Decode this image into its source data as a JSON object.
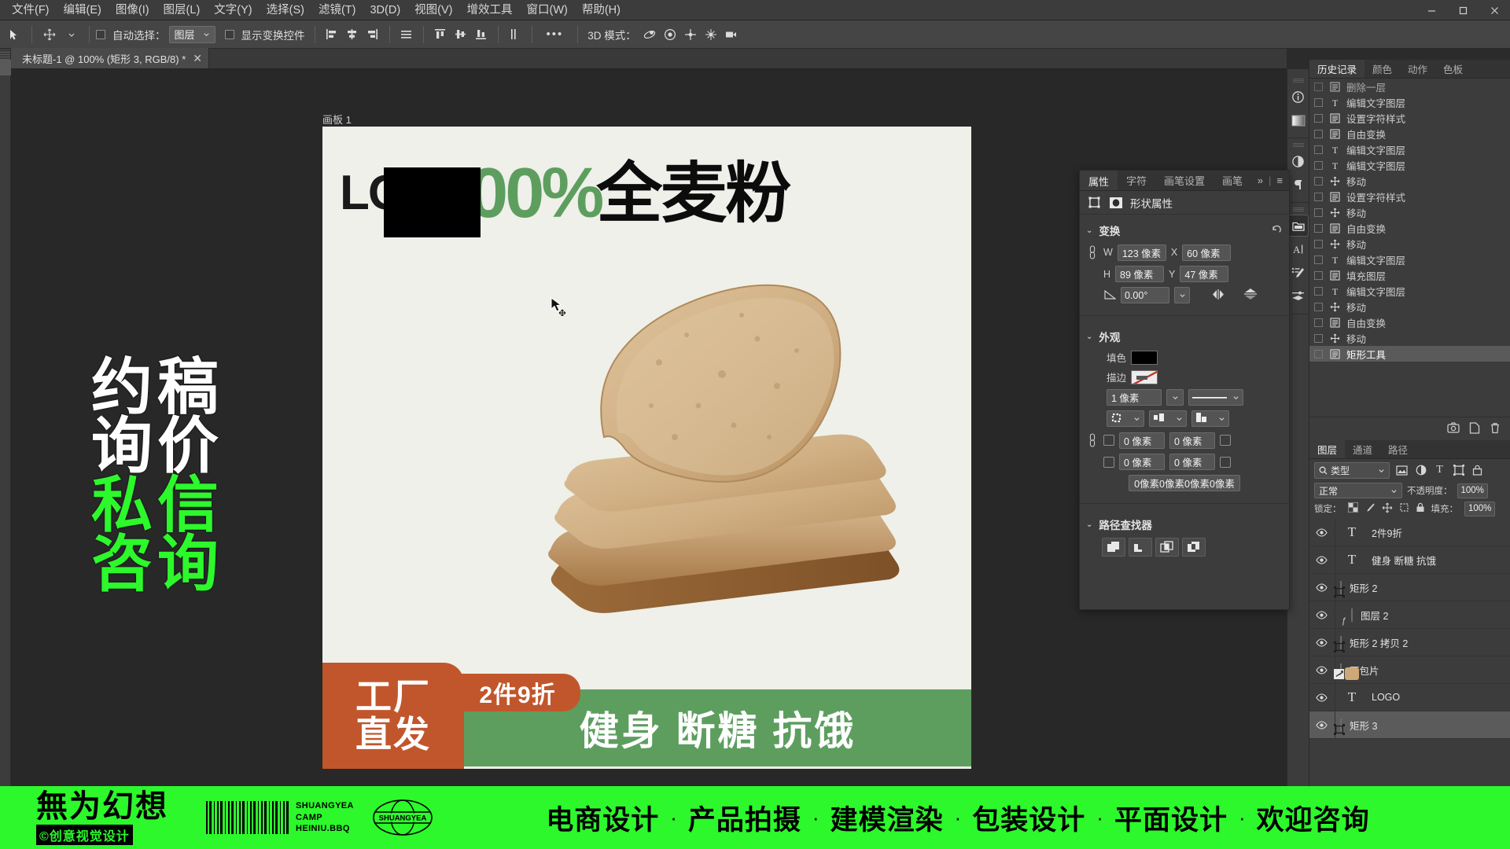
{
  "menubar": {
    "items": [
      "文件(F)",
      "编辑(E)",
      "图像(I)",
      "图层(L)",
      "文字(Y)",
      "选择(S)",
      "滤镜(T)",
      "3D(D)",
      "视图(V)",
      "增效工具",
      "窗口(W)",
      "帮助(H)"
    ],
    "window_controls": {
      "minimize": "─",
      "maximize": "▭",
      "close": "✕"
    }
  },
  "options_bar": {
    "move_tool_icon": "move-tool-icon",
    "auto_select_label": "自动选择：",
    "auto_select_value": "图层",
    "show_transform_label": "显示变换控件",
    "align_icons": [
      "align-left",
      "align-center-h",
      "align-right",
      "distribute-h",
      "align-top",
      "align-center-v",
      "align-bottom",
      "distribute-v"
    ],
    "more_label": "•••",
    "threed_label": "3D 模式：",
    "threed_icons": [
      "orbit-3d-icon",
      "roll-3d-icon",
      "pan-3d-icon",
      "slide-3d-icon",
      "camera-3d-icon"
    ]
  },
  "document_tab": {
    "title": "未标题-1 @ 100% (矩形 3, RGB/8) *",
    "close": "✕"
  },
  "canvas": {
    "artboard_label": "画板 1",
    "headline": {
      "logo_text": "LO",
      "percent": "100%",
      "chinese": "全麦粉",
      "percent_color": "#5d9e5f"
    },
    "banner": {
      "factory_line1": "工厂",
      "factory_line2": "直发",
      "deal": "2件9折",
      "slogan": "健身 断糖 抗饿",
      "orange": "#c1562c",
      "green": "#5d9e5f"
    }
  },
  "properties_panel": {
    "tabs": [
      "属性",
      "字符",
      "画笔设置",
      "画笔"
    ],
    "active_tab": "属性",
    "overflow_icon": "»",
    "menu_icon": "≡",
    "header_title": "形状属性",
    "transform": {
      "title": "变换",
      "reset_icon": "reset-icon",
      "w_label": "W",
      "w_value": "123 像素",
      "x_label": "X",
      "x_value": "60 像素",
      "h_label": "H",
      "h_value": "89 像素",
      "y_label": "Y",
      "y_value": "47 像素",
      "angle_value": "0.00°",
      "flip_h_icon": "flip-horizontal-icon",
      "flip_v_icon": "flip-vertical-icon",
      "link_icon": "link-icon"
    },
    "appearance": {
      "title": "外观",
      "fill_label": "填色",
      "fill_color": "#000000",
      "stroke_label": "描边",
      "stroke_width": "1 像素",
      "stroke_style_icon": "solid-line-icon",
      "stroke_align_icon": "stroke-align-icon",
      "stroke_cap_icon": "stroke-cap-icon",
      "stroke_corner_icon": "stroke-corner-icon",
      "radius_tl": "0 像素",
      "radius_tr": "0 像素",
      "radius_bl": "0 像素",
      "radius_br": "0 像素",
      "radius_summary": "0像素0像素0像素0像素"
    },
    "pathfinder": {
      "title": "路径查找器",
      "buttons": [
        "combine-shapes-icon",
        "subtract-front-icon",
        "intersect-shapes-icon",
        "exclude-overlap-icon"
      ]
    }
  },
  "history_panel": {
    "tabs": [
      "历史记录",
      "颜色",
      "动作",
      "色板"
    ],
    "active_tab": "历史记录",
    "items": [
      {
        "icon": "layer-icon",
        "label": "删除一层",
        "selected": false,
        "partial": true
      },
      {
        "icon": "type-icon",
        "label": "编辑文字图层",
        "selected": false
      },
      {
        "icon": "layer-icon",
        "label": "设置字符样式",
        "selected": false
      },
      {
        "icon": "layer-icon",
        "label": "自由变换",
        "selected": false
      },
      {
        "icon": "type-icon",
        "label": "编辑文字图层",
        "selected": false
      },
      {
        "icon": "type-icon",
        "label": "编辑文字图层",
        "selected": false
      },
      {
        "icon": "move-icon",
        "label": "移动",
        "selected": false
      },
      {
        "icon": "layer-icon",
        "label": "设置字符样式",
        "selected": false
      },
      {
        "icon": "move-icon",
        "label": "移动",
        "selected": false
      },
      {
        "icon": "layer-icon",
        "label": "自由变换",
        "selected": false
      },
      {
        "icon": "move-icon",
        "label": "移动",
        "selected": false
      },
      {
        "icon": "type-icon",
        "label": "编辑文字图层",
        "selected": false
      },
      {
        "icon": "layer-icon",
        "label": "填充图层",
        "selected": false
      },
      {
        "icon": "type-icon",
        "label": "编辑文字图层",
        "selected": false
      },
      {
        "icon": "move-icon",
        "label": "移动",
        "selected": false
      },
      {
        "icon": "layer-icon",
        "label": "自由变换",
        "selected": false
      },
      {
        "icon": "move-icon",
        "label": "移动",
        "selected": false
      },
      {
        "icon": "layer-icon",
        "label": "矩形工具",
        "selected": true
      }
    ],
    "footer_icons": [
      "snapshot-icon",
      "new-document-icon",
      "delete-icon"
    ]
  },
  "layers_panel": {
    "tabs": [
      "图层",
      "通道",
      "路径"
    ],
    "active_tab": "图层",
    "filter": {
      "search_icon": "search-icon",
      "type_label": "类型",
      "chevron": "⌄",
      "filters": [
        "image-filter-icon",
        "adjustment-filter-icon",
        "type-filter-icon",
        "shape-filter-icon",
        "smart-object-filter-icon"
      ],
      "toggle_icon": "filter-toggle-icon"
    },
    "blend": {
      "mode": "正常",
      "chevron": "⌄",
      "opacity_label": "不透明度：",
      "opacity_value": "100%"
    },
    "lock": {
      "label": "锁定：",
      "icons": [
        "lock-transparent-icon",
        "lock-image-icon",
        "lock-position-icon",
        "lock-artboard-icon",
        "lock-all-icon"
      ],
      "fill_label": "填充：",
      "fill_value": "100%"
    },
    "items": [
      {
        "kind": "text",
        "name": "2件9折",
        "visible": true,
        "selected": false
      },
      {
        "kind": "text",
        "name": "健身 断糖 抗饿",
        "visible": true,
        "selected": false
      },
      {
        "kind": "shape",
        "name": "矩形 2",
        "visible": true,
        "selected": false,
        "swatch": "#5d9e5f"
      },
      {
        "kind": "pixel",
        "name": "图层 2",
        "visible": true,
        "selected": false,
        "indented": true
      },
      {
        "kind": "shape",
        "name": "矩形 2 拷贝 2",
        "visible": true,
        "selected": false,
        "swatch": "#c1562c"
      },
      {
        "kind": "image",
        "name": "面包片",
        "visible": true,
        "selected": false,
        "swatch": "#cfa878"
      },
      {
        "kind": "text",
        "name": "LOGO",
        "visible": true,
        "selected": false
      },
      {
        "kind": "shape",
        "name": "矩形 3",
        "visible": true,
        "selected": true,
        "swatch": "#000000"
      }
    ]
  },
  "watermark_left": {
    "lines": [
      {
        "text": "约稿",
        "color": "#ffffff"
      },
      {
        "text": "询价",
        "color": "#ffffff"
      },
      {
        "text": "私信",
        "color": "#2cf82c"
      },
      {
        "text": "咨询",
        "color": "#2cf82c"
      }
    ]
  },
  "bottom_bar": {
    "background": "#2cf82c",
    "brand_main": "無为幻想",
    "brand_sub": "©创意视觉设计",
    "barcode_icon": "barcode-icon",
    "barcode_lines": [
      "SHUANGYEA",
      "CAMP",
      "HEINIU.BBQ"
    ],
    "globe_icon": "globe-logo-icon",
    "globe_text": "SHUANGYEA",
    "services": [
      "电商设计",
      "产品拍摄",
      "建模渲染",
      "包装设计",
      "平面设计",
      "欢迎咨询"
    ],
    "separator": "·"
  }
}
